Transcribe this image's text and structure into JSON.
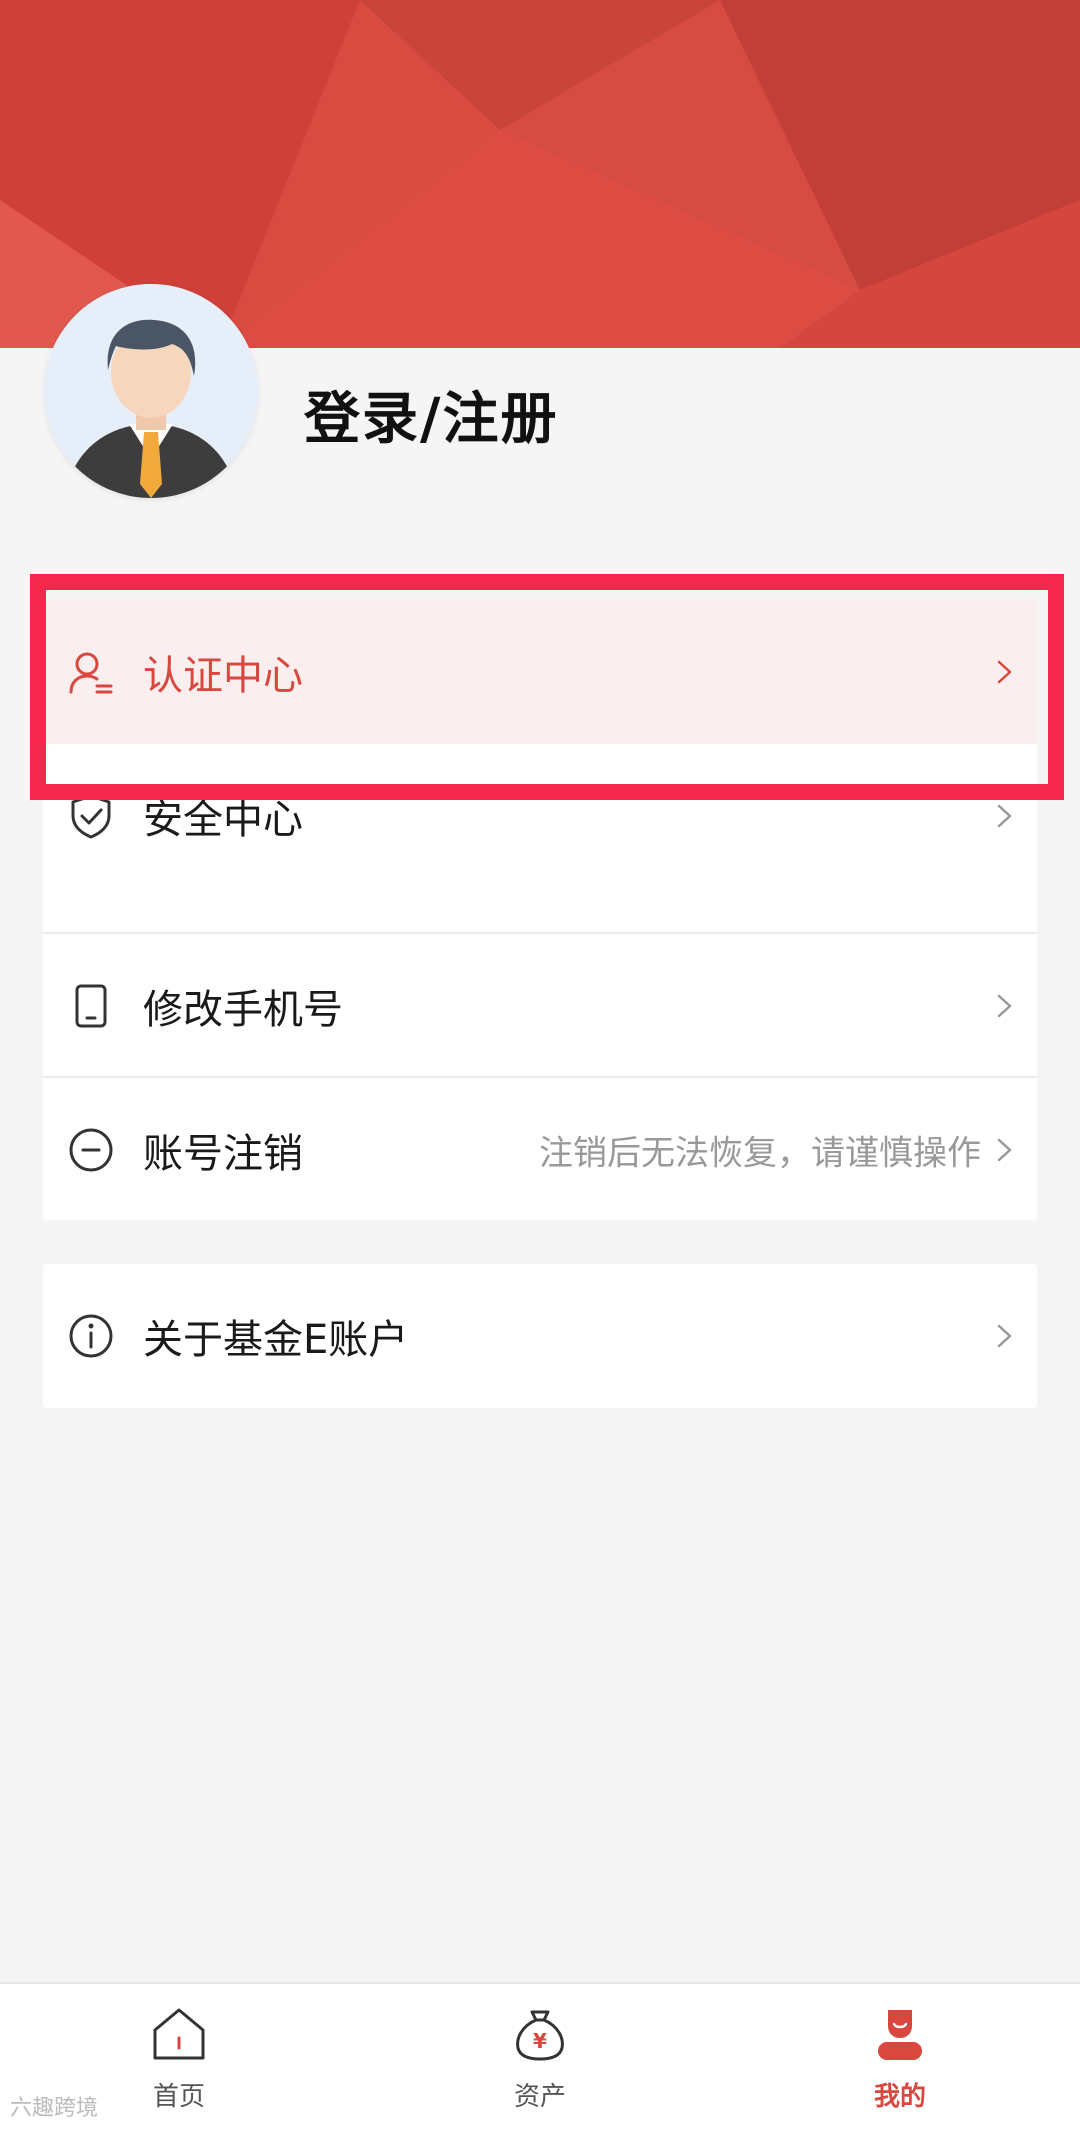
{
  "header": {
    "login_label": "登录/注册",
    "banner_color": "#d94a40",
    "accent": "#d9473f"
  },
  "menu_group_1": [
    {
      "label": "认证中心",
      "icon": "user-verify-icon",
      "note": ""
    },
    {
      "label": "安全中心",
      "icon": "shield-check-icon",
      "note": ""
    },
    {
      "label": "修改手机号",
      "icon": "phone-icon",
      "note": ""
    },
    {
      "label": "账号注销",
      "icon": "minus-circle-icon",
      "note": "注销后无法恢复，请谨慎操作"
    }
  ],
  "menu_group_2": [
    {
      "label": "关于基金E账户",
      "icon": "info-icon",
      "note": ""
    }
  ],
  "tabbar": {
    "tabs": [
      {
        "label": "首页",
        "icon": "home-icon",
        "active": false
      },
      {
        "label": "资产",
        "icon": "money-bag-icon",
        "active": false
      },
      {
        "label": "我的",
        "icon": "profile-icon",
        "active": true
      }
    ]
  },
  "watermark": "六趣跨境"
}
